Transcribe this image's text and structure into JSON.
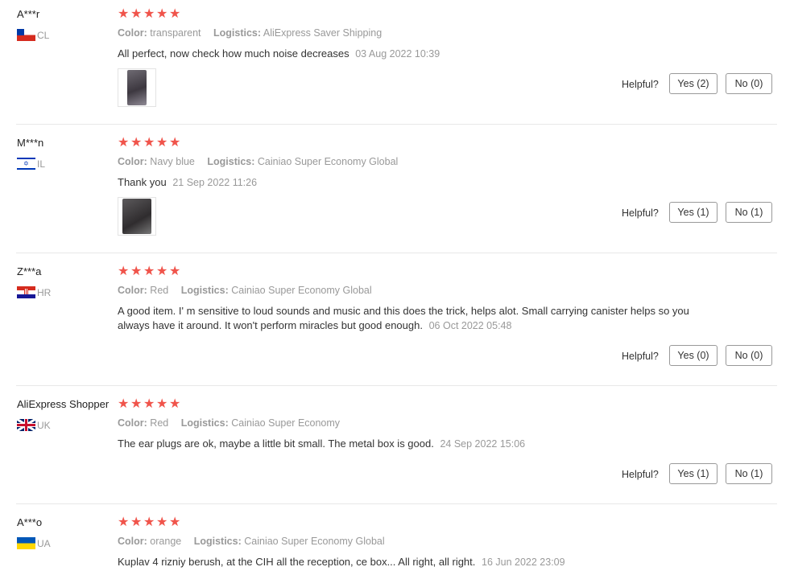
{
  "labels": {
    "color": "Color:",
    "logistics": "Logistics:",
    "helpful": "Helpful?"
  },
  "colors": {
    "star": "#f0544b",
    "muted": "#999999",
    "text": "#333333"
  },
  "reviews": [
    {
      "user": "A***r",
      "country": "CL",
      "flag": "chile-flag-icon",
      "rating": 5,
      "color": "transparent",
      "logistics": "AliExpress Saver Shipping",
      "text": "All perfect, now check how much noise decreases",
      "date": "03 Aug 2022 10:39",
      "has_image": true,
      "yes": "Yes (2)",
      "no": "No (0)"
    },
    {
      "user": "M***n",
      "country": "IL",
      "flag": "israel-flag-icon",
      "rating": 5,
      "color": "Navy blue",
      "logistics": "Cainiao Super Economy Global",
      "text": "Thank you",
      "date": "21 Sep 2022 11:26",
      "has_image": true,
      "yes": "Yes (1)",
      "no": "No (1)"
    },
    {
      "user": "Z***a",
      "country": "HR",
      "flag": "croatia-flag-icon",
      "rating": 5,
      "color": "Red",
      "logistics": "Cainiao Super Economy Global",
      "text": "A good item. I' m sensitive to loud sounds and music and this does the trick, helps alot. Small carrying canister helps so you always have it around. It won't perform miracles but good enough.",
      "date": "06 Oct 2022 05:48",
      "has_image": false,
      "yes": "Yes (0)",
      "no": "No (0)"
    },
    {
      "user": "AliExpress Shopper",
      "country": "UK",
      "flag": "uk-flag-icon",
      "rating": 5,
      "color": "Red",
      "logistics": "Cainiao Super Economy",
      "text": "The ear plugs are ok, maybe a little bit small. The metal box is good.",
      "date": "24 Sep 2022 15:06",
      "has_image": false,
      "yes": "Yes (1)",
      "no": "No (1)"
    },
    {
      "user": "A***o",
      "country": "UA",
      "flag": "ukraine-flag-icon",
      "rating": 5,
      "color": "orange",
      "logistics": "Cainiao Super Economy Global",
      "text": "Kuplav 4 rizniy berush, at the CIH all the reception, ce box... All right, all right.",
      "date": "16 Jun 2022 23:09",
      "has_image": false,
      "yes": "",
      "no": ""
    }
  ]
}
